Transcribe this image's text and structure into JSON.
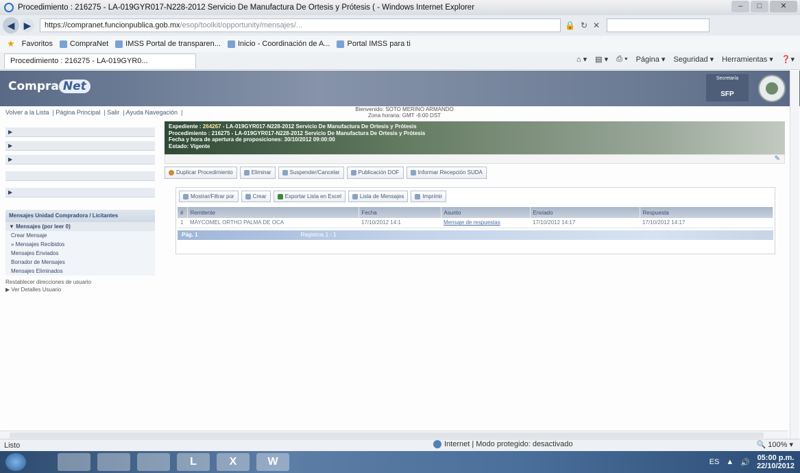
{
  "window": {
    "title": "Procedimiento : 216275 - LA-019GYR017-N228-2012 Servicio De Manufactura De Ortesis y Prótesis ( - Windows Internet Explorer",
    "url_main": "https://compranet.funcionpublica.gob.mx",
    "url_tail": "/esop/toolkit/opportunity/mensajes/..."
  },
  "favorites": {
    "label": "Favoritos",
    "items": [
      "CompraNet",
      "IMSS Portal de transparen...",
      "Inicio - Coordinación de A...",
      "Portal IMSS para ti"
    ]
  },
  "tab": {
    "label": "Procedimiento : 216275 - LA-019GYR0..."
  },
  "commands": [
    "Página ▾",
    "Seguridad ▾",
    "Herramientas ▾"
  ],
  "header": {
    "logo_left": "Compra",
    "logo_right": "Net",
    "badge_small": "Secretaría",
    "badge_big": "SFP"
  },
  "toplinks": [
    "Volver a la Lista",
    "Página Principal",
    "Salir",
    "Ayuda Navegación"
  ],
  "welcome": {
    "line1": "Bienvenido: SOTO MERINO ARMANDO",
    "line2": "Zona horaria: GMT -6:00 DST"
  },
  "sidebar": {
    "section_title": "Mensajes Unidad Compradora / Licitantes",
    "sub_header": "Mensajes (por leer 0)",
    "sub_items": [
      "Crear Mensaje",
      "Mensajes Recibidos",
      "Mensajes Enviados",
      "Borrador de Mensajes",
      "Mensajes Eliminados"
    ],
    "footer_line1": "Restablecer direcciones de usuario",
    "footer_line2": "Ver Detalles Usuario"
  },
  "expediente": {
    "line1_prefix": "Expediente : ",
    "line1_link": "264267",
    "line1_rest": " - LA-019GYR017-N228-2012 Servicio De Manufactura De Ortesis y Prótesis",
    "line2": "Procedimiento : 216275 - LA-019GYR017-N228-2012 Servicio De Manufactura De Ortesis y Prótesis",
    "line3": "Fecha y hora de apertura de proposiciones: 30/10/2012 09:00:00",
    "line4": "Estado: Vigente"
  },
  "actions": [
    "Duplicar Procedimiento",
    "Eliminar",
    "Suspender/Cancelar",
    "Publicación DOF",
    "Informar Recepción SUDA"
  ],
  "msg_toolbar": [
    "Mostrar/Filtrar por",
    "Crear",
    "Exportar Lista en Excel",
    "Lista de Mensajes",
    "Imprimir"
  ],
  "table": {
    "headers": [
      "#",
      "Remitente",
      "Fecha",
      "Asunto",
      "Enviado",
      "Respuesta"
    ],
    "rows": [
      [
        "1",
        "MAYCOMEL ORTHO PALMA DE OCA",
        "17/10/2012 14:1",
        "Mensaje de respuestas",
        "17/10/2012 14:17",
        "17/10/2012 14:17"
      ]
    ]
  },
  "pager": {
    "left": "Pág. 1",
    "center": "Registros 1 - 1"
  },
  "status": {
    "ready": "Listo",
    "zone": "Internet | Modo protegido: desactivado",
    "zoom": "100%"
  },
  "taskbar": {
    "apps": [
      "",
      "",
      "",
      "L",
      "X",
      "W"
    ],
    "time": "05:00 p.m.",
    "date": "22/10/2012"
  }
}
